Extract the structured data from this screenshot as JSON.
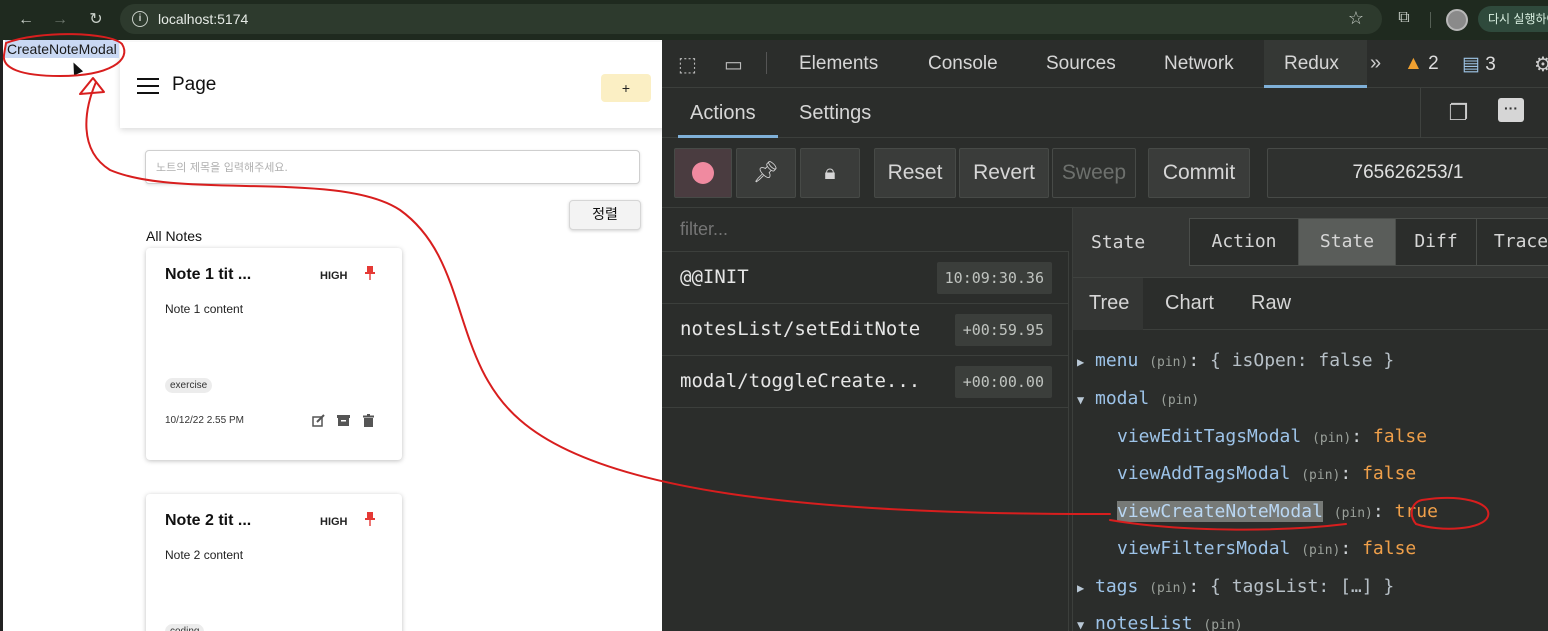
{
  "browser": {
    "url": "localhost:5174",
    "update_label": "다시 실행하여",
    "back_icon": "arrow-left-icon",
    "forward_icon": "arrow-right-icon",
    "reload_icon": "reload-icon"
  },
  "app": {
    "annotation_label": "CreateNoteModal",
    "header_title": "Page",
    "add_button": "+",
    "title_input_placeholder": "노트의 제목을 입력해주세요.",
    "sort_button": "정렬",
    "all_notes_label": "All Notes",
    "notes": [
      {
        "title": "Note 1 tit ...",
        "priority": "HIGH",
        "content": "Note 1 content",
        "tag": "exercise",
        "date": "10/12/22 2.55 PM"
      },
      {
        "title": "Note 2 tit ...",
        "priority": "HIGH",
        "content": "Note 2 content",
        "tag": "coding"
      }
    ],
    "colors": {
      "pin": "#e53935",
      "add_button_bg": "#fbefc4"
    }
  },
  "devtools": {
    "tabs": [
      "Elements",
      "Console",
      "Sources",
      "Network",
      "Redux"
    ],
    "active_tab": "Redux",
    "warning_count": "2",
    "message_count": "3",
    "redux": {
      "subtabs": [
        "Actions",
        "Settings"
      ],
      "toolbar": {
        "reset": "Reset",
        "revert": "Revert",
        "sweep": "Sweep",
        "commit": "Commit",
        "counter": "765626253/1"
      },
      "filter_placeholder": "filter...",
      "actions": [
        {
          "name": "@@INIT",
          "time": "10:09:30.36"
        },
        {
          "name": "notesList/setEditNote",
          "time": "+00:59.95"
        },
        {
          "name": "modal/toggleCreate...",
          "time": "+00:00.00"
        }
      ],
      "state_label": "State",
      "segments": [
        "Action",
        "State",
        "Diff",
        "Trace"
      ],
      "active_segment": "State",
      "view_tabs": [
        "Tree",
        "Chart",
        "Raw"
      ],
      "tree": {
        "menu_key": "menu",
        "menu_value": "{ isOpen: false }",
        "modal_key": "modal",
        "pin": "(pin)",
        "modal_children": [
          {
            "key": "viewEditTagsModal",
            "value": "false"
          },
          {
            "key": "viewAddTagsModal",
            "value": "false"
          },
          {
            "key": "viewCreateNoteModal",
            "value": "true"
          },
          {
            "key": "viewFiltersModal",
            "value": "false"
          }
        ],
        "tags_key": "tags",
        "tags_value": "{ tagsList: […] }",
        "notes_key": "notesList"
      }
    }
  },
  "annotation_color": "#d81e1e"
}
